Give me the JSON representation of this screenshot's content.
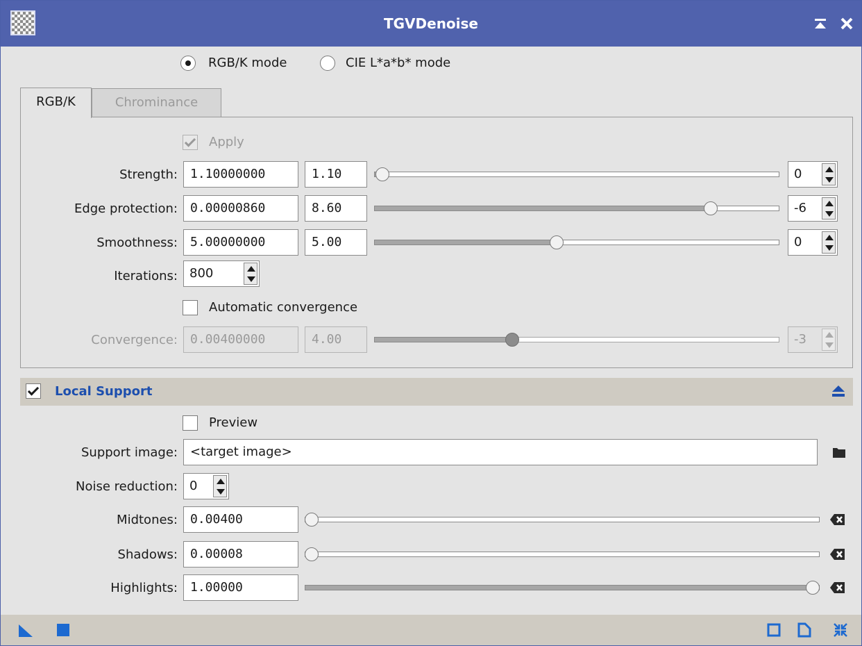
{
  "window": {
    "title": "TGVDenoise"
  },
  "mode": {
    "rgbk_label": "RGB/K mode",
    "cielab_label": "CIE L*a*b* mode",
    "selected": "RGB/K mode"
  },
  "tabs": [
    {
      "label": "RGB/K",
      "active": true
    },
    {
      "label": "Chrominance",
      "active": false
    }
  ],
  "rgbk": {
    "apply_label": "Apply",
    "apply_checked": true,
    "strength": {
      "label": "Strength:",
      "value": "1.10000000",
      "short": "1.10",
      "exp": "0",
      "slider": 0.02
    },
    "edge_protection": {
      "label": "Edge protection:",
      "value": "0.00000860",
      "short": "8.60",
      "exp": "-6",
      "slider": 0.83
    },
    "smoothness": {
      "label": "Smoothness:",
      "value": "5.00000000",
      "short": "5.00",
      "exp": "0",
      "slider": 0.45
    },
    "iterations": {
      "label": "Iterations:",
      "value": "800"
    },
    "auto_convergence": {
      "label": "Automatic convergence",
      "checked": false
    },
    "convergence": {
      "label": "Convergence:",
      "value": "0.00400000",
      "short": "4.00",
      "exp": "-3",
      "slider": 0.34
    }
  },
  "local_support": {
    "title": "Local Support",
    "enabled": true,
    "preview": {
      "label": "Preview",
      "checked": false
    },
    "support_image": {
      "label": "Support image:",
      "value": "<target image>"
    },
    "noise_reduction": {
      "label": "Noise reduction:",
      "value": "0"
    },
    "midtones": {
      "label": "Midtones:",
      "value": "0.00400",
      "slider": 0.004
    },
    "shadows": {
      "label": "Shadows:",
      "value": "0.00008",
      "slider": 0.0
    },
    "highlights": {
      "label": "Highlights:",
      "value": "1.00000",
      "slider": 1.0
    }
  },
  "colors": {
    "title_bar": "#5062ad",
    "accent": "#1d4fae",
    "section_bar": "#cfcbc2",
    "background": "#e4e4e4"
  },
  "icons": [
    "app-icon",
    "shade-icon",
    "close-icon",
    "collapse-icon",
    "folder-icon",
    "clear-icon",
    "new-instance-icon",
    "apply-global-icon",
    "preview-icon",
    "reset-icon",
    "documentation-icon"
  ]
}
